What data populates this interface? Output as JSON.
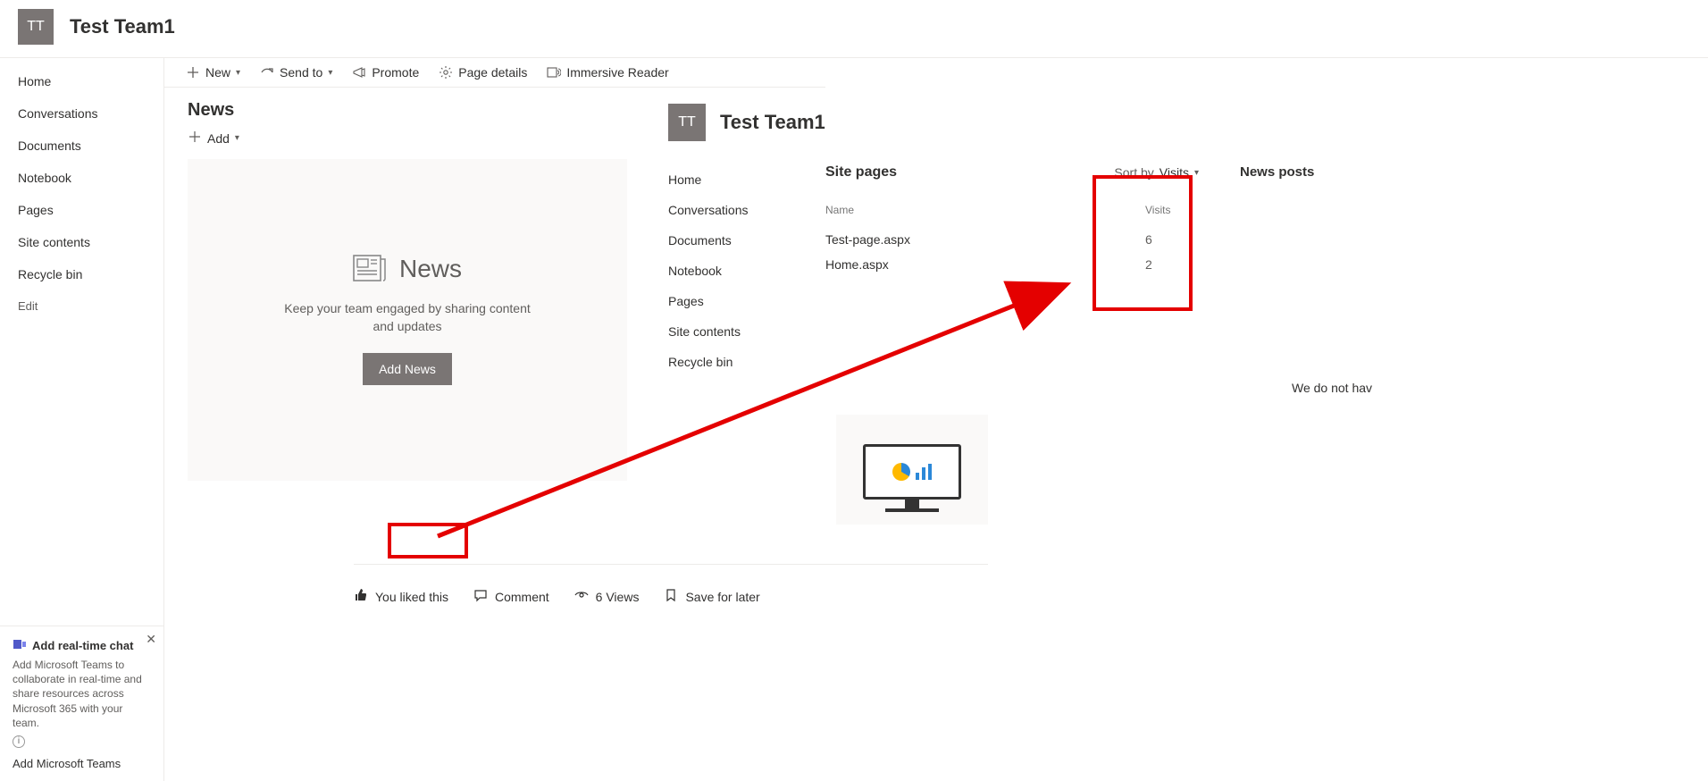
{
  "site": {
    "logo_text": "TT",
    "title": "Test Team1"
  },
  "left_nav": {
    "items": [
      "Home",
      "Conversations",
      "Documents",
      "Notebook",
      "Pages",
      "Site contents",
      "Recycle bin"
    ],
    "edit": "Edit"
  },
  "teams_promo": {
    "title": "Add real-time chat",
    "desc": "Add Microsoft Teams to collaborate in real-time and share resources across Microsoft 365 with your team.",
    "cta": "Add Microsoft Teams"
  },
  "toolbar": {
    "new": "New",
    "sendto": "Send to",
    "promote": "Promote",
    "page_details": "Page details",
    "immersive": "Immersive Reader"
  },
  "page": {
    "heading": "News",
    "add": "Add"
  },
  "news_card": {
    "label": "News",
    "sub": "Keep your team engaged by sharing content and updates",
    "button": "Add News"
  },
  "social": {
    "liked": "You liked this",
    "comment": "Comment",
    "views": "6 Views",
    "save": "Save for later"
  },
  "overlay": {
    "site": {
      "logo_text": "TT",
      "title": "Test Team1"
    },
    "nav": [
      "Home",
      "Conversations",
      "Documents",
      "Notebook",
      "Pages",
      "Site contents",
      "Recycle bin"
    ],
    "main_title": "Site pages",
    "sort_label": "Sort by",
    "sort_value": "Visits",
    "columns": {
      "name": "Name",
      "visits": "Visits"
    },
    "rows": [
      {
        "name": "Test-page.aspx",
        "visits": "6"
      },
      {
        "name": "Home.aspx",
        "visits": "2"
      }
    ],
    "right_title": "News posts"
  },
  "truncated_text": "We do not hav"
}
